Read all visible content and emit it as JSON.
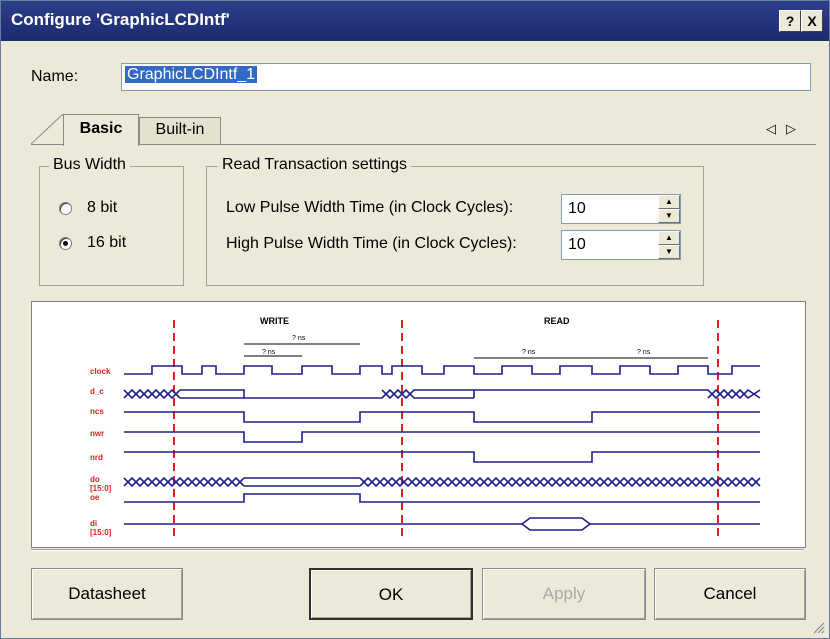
{
  "window": {
    "title": "Configure 'GraphicLCDIntf'",
    "help_label": "?",
    "close_label": "X"
  },
  "name_field": {
    "label": "Name:",
    "value": "GraphicLCDIntf_1"
  },
  "tabs": [
    {
      "label": "Basic",
      "active": true
    },
    {
      "label": "Built-in",
      "active": false
    }
  ],
  "tab_scroll": {
    "left": "◁",
    "right": "▷"
  },
  "bus_width": {
    "legend": "Bus Width",
    "options": [
      {
        "label": "8 bit",
        "selected": false
      },
      {
        "label": "16 bit",
        "selected": true
      }
    ]
  },
  "read_settings": {
    "legend": "Read Transaction settings",
    "low_pulse": {
      "label": "Low Pulse Width Time (in Clock Cycles):",
      "value": "10"
    },
    "high_pulse": {
      "label": "High Pulse Width Time (in Clock Cycles):",
      "value": "10"
    }
  },
  "timing_diagram": {
    "write_label": "WRITE",
    "read_label": "READ",
    "signals": [
      "clock",
      "d_c",
      "ncs",
      "nwr",
      "nrd",
      "do [15:0] oe",
      "di [15:0]"
    ],
    "sig_clock": "clock",
    "sig_dc": "d_c",
    "sig_ncs": "ncs",
    "sig_nwr": "nwr",
    "sig_nrd": "nrd",
    "sig_do": "do",
    "sig_do_bus": "[15:0]",
    "sig_oe": "oe",
    "sig_di": "di",
    "sig_di_bus": "[15:0]",
    "ns_label": "? ns",
    "colors": {
      "signal": "#1f1f8f",
      "label": "#e02020",
      "marker": "#e02020"
    }
  },
  "buttons": {
    "datasheet": "Datasheet",
    "ok": "OK",
    "apply": "Apply",
    "cancel": "Cancel"
  }
}
